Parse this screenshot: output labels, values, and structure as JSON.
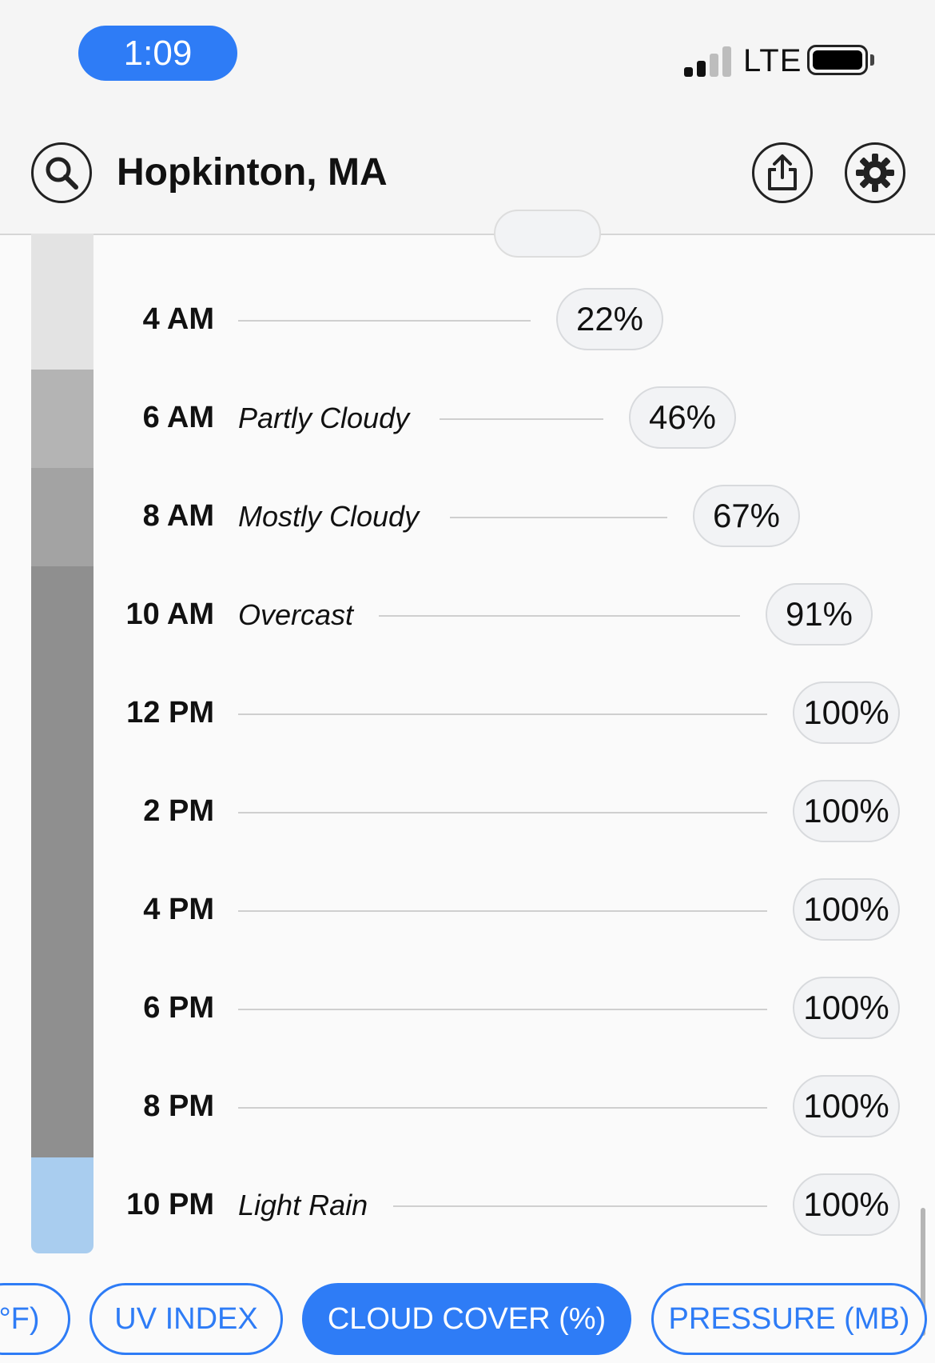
{
  "status_bar": {
    "time": "1:09",
    "network": "LTE",
    "signal_bars_filled": 2,
    "signal_bars_total": 4,
    "battery_level": 1.0
  },
  "header": {
    "location": "Hopkinton, MA",
    "icons": [
      "search-icon",
      "share-icon",
      "gear-icon"
    ]
  },
  "colors": {
    "accent": "#2e7cf6",
    "strip_clear": "#e3e3e3",
    "strip_partly": "#b4b4b4",
    "strip_mostly": "#a3a3a3",
    "strip_overcast": "#8f8f8f",
    "strip_rain": "#a9cdef"
  },
  "forecast": [
    {
      "time": "4 AM",
      "condition": "",
      "value": "22%"
    },
    {
      "time": "6 AM",
      "condition": "Partly Cloudy",
      "value": "46%"
    },
    {
      "time": "8 AM",
      "condition": "Mostly Cloudy",
      "value": "67%"
    },
    {
      "time": "10 AM",
      "condition": "Overcast",
      "value": "91%"
    },
    {
      "time": "12 PM",
      "condition": "",
      "value": "100%"
    },
    {
      "time": "2 PM",
      "condition": "",
      "value": "100%"
    },
    {
      "time": "4 PM",
      "condition": "",
      "value": "100%"
    },
    {
      "time": "6 PM",
      "condition": "",
      "value": "100%"
    },
    {
      "time": "8 PM",
      "condition": "",
      "value": "100%"
    },
    {
      "time": "10 PM",
      "condition": "Light Rain",
      "value": "100%"
    }
  ],
  "tabs": [
    {
      "label": "°F)",
      "active": false
    },
    {
      "label": "UV INDEX",
      "active": false
    },
    {
      "label": "CLOUD COVER (%)",
      "active": true
    },
    {
      "label": "PRESSURE (MB)",
      "active": false
    }
  ]
}
